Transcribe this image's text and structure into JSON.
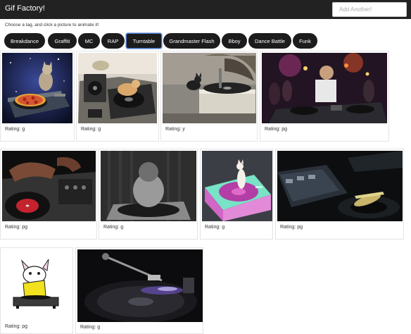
{
  "app": {
    "title": "Gif Factory!"
  },
  "add": {
    "placeholder": "Add Another!"
  },
  "instructions": "Choose a tag, and click a picture to animate it!",
  "tags": [
    "Breakdance",
    "Graffiti",
    "MC",
    "RAP",
    "Turntable",
    "Grandmaster Flash",
    "Bboy",
    "Dance Battle",
    "Funk"
  ],
  "active_tag": "Turntable",
  "rating_label": "Rating:",
  "gifs": [
    {
      "rating": "g",
      "icon": "cat-dj-pizza-space-gif"
    },
    {
      "rating": "g",
      "icon": "cats-on-turntables-gif"
    },
    {
      "rating": "y",
      "icon": "cat-on-phonograph-gif"
    },
    {
      "rating": "pg",
      "icon": "dj-club-stage-gif"
    },
    {
      "rating": "pg",
      "icon": "hand-scratching-record-gif"
    },
    {
      "rating": "g",
      "icon": "baby-on-turntable-gif"
    },
    {
      "rating": "g",
      "icon": "cat-spinning-on-turntable-gif"
    },
    {
      "rating": "pg",
      "icon": "rotating-turntables-gif"
    },
    {
      "rating": "pg",
      "icon": "cartoon-cat-dj-gif"
    },
    {
      "rating": "g",
      "icon": "turntable-close-up-gif"
    }
  ]
}
